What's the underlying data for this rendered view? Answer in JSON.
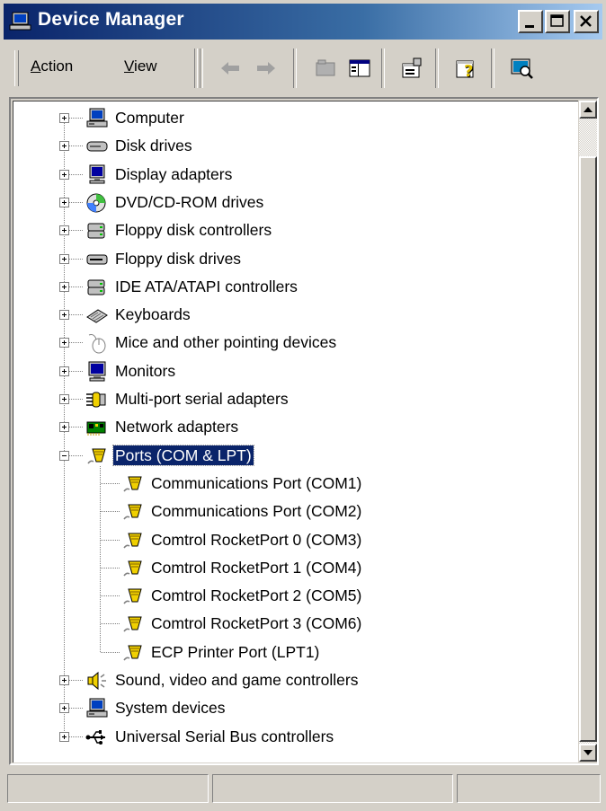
{
  "window": {
    "title": "Device Manager",
    "buttons": {
      "minimize": "minimize",
      "maximize": "maximize",
      "close": "close"
    }
  },
  "menu": {
    "action": {
      "label": "Action",
      "accel": "A",
      "rest": "ction"
    },
    "view": {
      "label": "View",
      "accel": "V",
      "rest": "iew"
    }
  },
  "toolbar": {
    "icons": [
      "back-arrow-icon",
      "forward-arrow-icon",
      "up-folder-icon",
      "show-hide-tree-icon",
      "properties-icon",
      "help-icon",
      "scan-hardware-icon"
    ]
  },
  "tree": {
    "categories": [
      {
        "label": "Computer",
        "icon": "computer-icon",
        "expanded": false
      },
      {
        "label": "Disk drives",
        "icon": "disk-drive-icon",
        "expanded": false
      },
      {
        "label": "Display adapters",
        "icon": "display-adapter-icon",
        "expanded": false
      },
      {
        "label": "DVD/CD-ROM drives",
        "icon": "cdrom-icon",
        "expanded": false
      },
      {
        "label": "Floppy disk controllers",
        "icon": "controller-icon",
        "expanded": false
      },
      {
        "label": "Floppy disk drives",
        "icon": "floppy-drive-icon",
        "expanded": false
      },
      {
        "label": "IDE ATA/ATAPI controllers",
        "icon": "controller-icon",
        "expanded": false
      },
      {
        "label": "Keyboards",
        "icon": "keyboard-icon",
        "expanded": false
      },
      {
        "label": "Mice and other pointing devices",
        "icon": "mouse-icon",
        "expanded": false
      },
      {
        "label": "Monitors",
        "icon": "monitor-icon",
        "expanded": false
      },
      {
        "label": "Multi-port serial adapters",
        "icon": "serial-adapter-icon",
        "expanded": false
      },
      {
        "label": "Network adapters",
        "icon": "network-adapter-icon",
        "expanded": false
      },
      {
        "label": "Ports (COM & LPT)",
        "icon": "port-icon",
        "expanded": true,
        "selected": true,
        "children": [
          "Communications Port (COM1)",
          "Communications Port (COM2)",
          "Comtrol RocketPort 0 (COM3)",
          "Comtrol RocketPort 1 (COM4)",
          "Comtrol RocketPort 2 (COM5)",
          "Comtrol RocketPort 3 (COM6)",
          "ECP Printer Port (LPT1)"
        ]
      },
      {
        "label": "Sound, video and game controllers",
        "icon": "speaker-icon",
        "expanded": false
      },
      {
        "label": "System devices",
        "icon": "computer-icon",
        "expanded": false
      },
      {
        "label": "Universal Serial Bus controllers",
        "icon": "usb-icon",
        "expanded": false
      }
    ]
  },
  "statusbar": {
    "panes": [
      "",
      "",
      ""
    ]
  },
  "colors": {
    "title_start": "#0a246a",
    "title_end": "#a6caf0",
    "selection": "#0a246a",
    "face": "#d4d0c8"
  }
}
